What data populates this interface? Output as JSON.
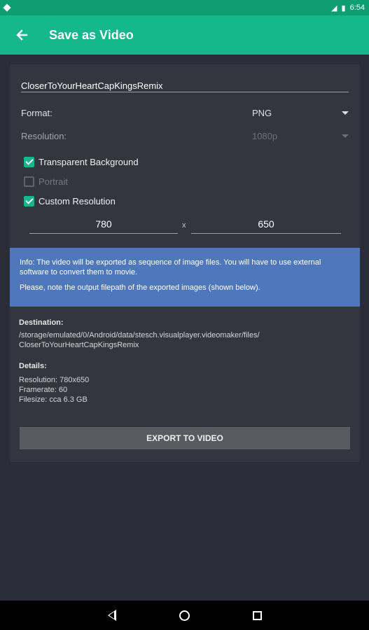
{
  "status": {
    "time": "6:54"
  },
  "appbar": {
    "title": "Save as Video",
    "back_icon": "arrow-left-icon"
  },
  "form": {
    "filename": "CloserToYourHeartCapKingsRemix",
    "format": {
      "label": "Format:",
      "value": "PNG"
    },
    "resolution": {
      "label": "Resolution:",
      "value": "1080p",
      "disabled": true
    },
    "transparent_background": {
      "label": "Transparent Background",
      "checked": true
    },
    "portrait": {
      "label": "Portrait",
      "checked": false,
      "disabled": true
    },
    "custom_resolution": {
      "label": "Custom Resolution",
      "checked": true
    },
    "width": "780",
    "height": "650",
    "separator": "x"
  },
  "info": {
    "line1": "Info: The video will be exported as sequence of image files. You will have to use external software to convert them to movie.",
    "line2": "Please, note the output filepath of the exported images (shown below)."
  },
  "destination": {
    "heading": "Destination:",
    "path_line1": "/storage/emulated/0/Android/data/stesch.visualplayer.videomaker/files/",
    "path_line2": "CloserToYourHeartCapKingsRemix"
  },
  "details": {
    "heading": "Details:",
    "resolution": "Resolution: 780x650",
    "framerate": "Framerate: 60",
    "filesize": "Filesize: cca 6.3 GB"
  },
  "export_button": "EXPORT TO VIDEO",
  "colors": {
    "accent": "#14b88a",
    "info_bg": "#4f78bc",
    "background": "#2a2d37",
    "card": "#33363f"
  }
}
